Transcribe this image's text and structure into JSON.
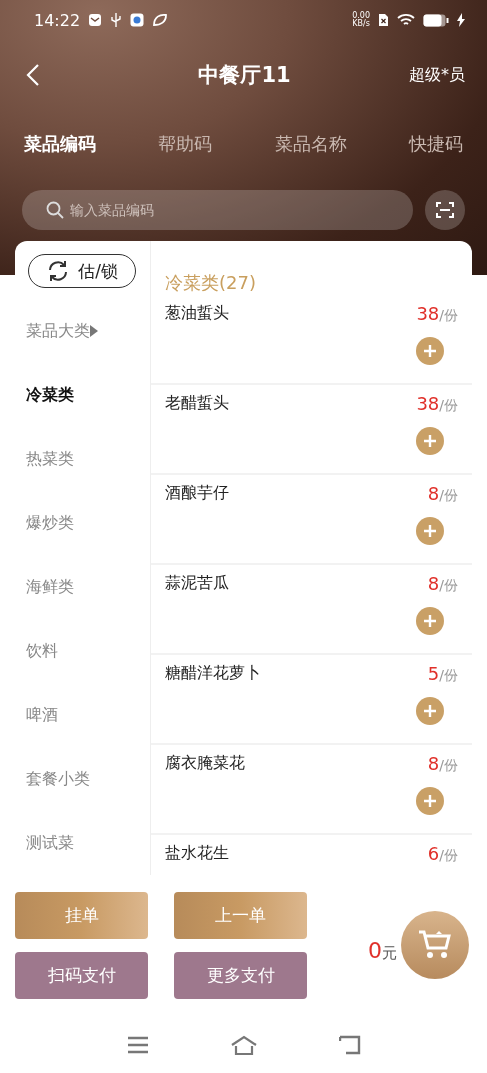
{
  "status_bar": {
    "time": "14:22",
    "net_speed": "0.00",
    "net_unit": "KB/s"
  },
  "header": {
    "title": "中餐厅11",
    "user": "超级*员"
  },
  "tabs": [
    {
      "label": "菜品编码",
      "selected": true
    },
    {
      "label": "帮助码",
      "selected": false
    },
    {
      "label": "菜品名称",
      "selected": false
    },
    {
      "label": "快捷码",
      "selected": false
    }
  ],
  "search": {
    "placeholder": "输入菜品编码"
  },
  "estimate_lock_button": "估/锁",
  "categories": [
    {
      "label": "菜品大类",
      "kind": "group",
      "selected": false
    },
    {
      "label": "冷菜类",
      "kind": "category",
      "selected": true
    },
    {
      "label": "热菜类",
      "kind": "category",
      "selected": false
    },
    {
      "label": "爆炒类",
      "kind": "category",
      "selected": false
    },
    {
      "label": "海鲜类",
      "kind": "category",
      "selected": false
    },
    {
      "label": "饮料",
      "kind": "category",
      "selected": false
    },
    {
      "label": "啤酒",
      "kind": "category",
      "selected": false
    },
    {
      "label": "套餐小类",
      "kind": "category",
      "selected": false
    },
    {
      "label": "测试菜",
      "kind": "category",
      "selected": false
    }
  ],
  "section_title": "冷菜类(27)",
  "dishes": [
    {
      "name": "葱油蜇头",
      "price": "38",
      "unit": "/份",
      "add_button": true
    },
    {
      "name": "老醋蜇头",
      "price": "38",
      "unit": "/份",
      "add_button": true
    },
    {
      "name": "酒酿芋仔",
      "price": "8",
      "unit": "/份",
      "add_button": true
    },
    {
      "name": "蒜泥苦瓜",
      "price": "8",
      "unit": "/份",
      "add_button": true
    },
    {
      "name": "糖醋洋花萝卜",
      "price": "5",
      "unit": "/份",
      "add_button": true
    },
    {
      "name": "腐衣腌菜花",
      "price": "8",
      "unit": "/份",
      "add_button": true
    },
    {
      "name": "盐水花生",
      "price": "6",
      "unit": "/份",
      "add_button": false
    }
  ],
  "actions": [
    {
      "label": "挂单",
      "kind": "gold"
    },
    {
      "label": "上一单",
      "kind": "gold"
    },
    {
      "label": "扫码支付",
      "kind": "mauve"
    },
    {
      "label": "更多支付",
      "kind": "mauve"
    }
  ],
  "total": {
    "amount": "0",
    "currency": "元"
  }
}
